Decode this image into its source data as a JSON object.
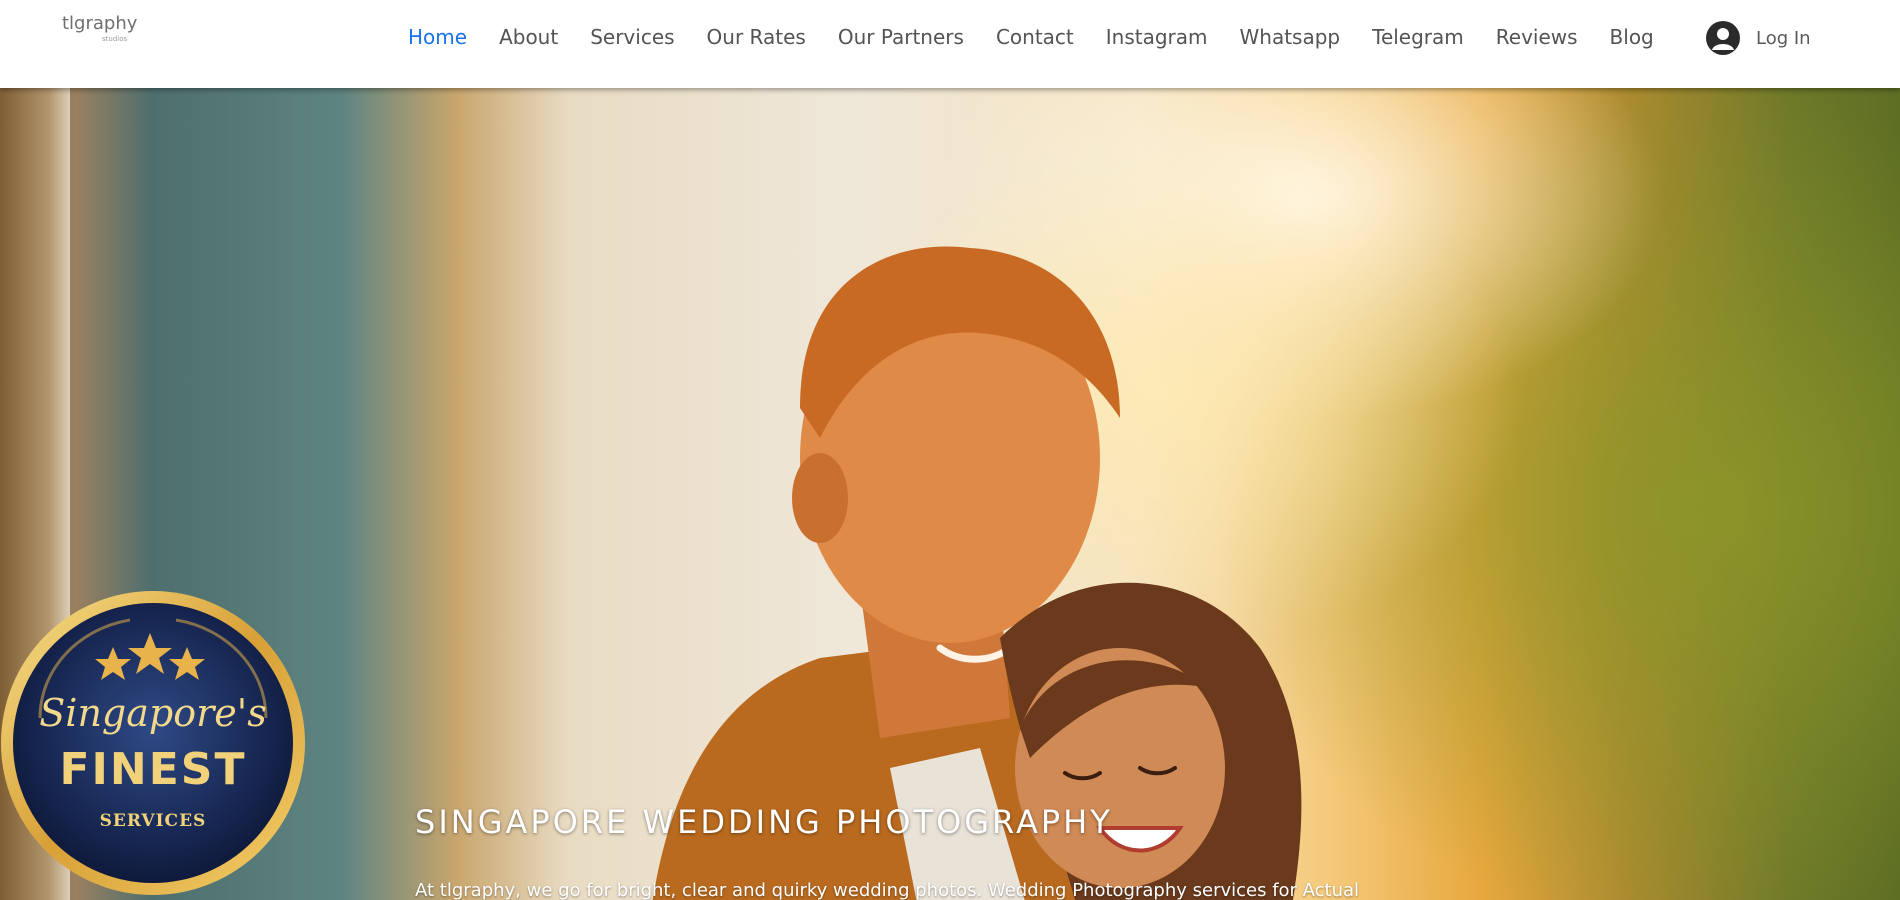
{
  "logo": {
    "main": "tlgraphy",
    "sub": "studios"
  },
  "nav": {
    "items": [
      {
        "label": "Home",
        "active": true
      },
      {
        "label": "About"
      },
      {
        "label": "Services"
      },
      {
        "label": "Our Rates"
      },
      {
        "label": "Our Partners"
      },
      {
        "label": "Contact"
      },
      {
        "label": "Instagram"
      },
      {
        "label": "Whatsapp"
      },
      {
        "label": "Telegram"
      },
      {
        "label": "Reviews"
      },
      {
        "label": "Blog"
      }
    ],
    "active_color": "#1a73e8",
    "text_color": "#545454"
  },
  "login": {
    "label": "Log In",
    "icon": "user-avatar-icon"
  },
  "badge": {
    "line1": "Singapore's",
    "line2": "FINEST",
    "line3": "SERVICES",
    "stars": 3
  },
  "hero": {
    "title": "SINGAPORE WEDDING PHOTOGRAPHY",
    "description": "At tlgraphy, we go for bright, clear and quirky wedding photos. Wedding Photography services for Actual"
  }
}
